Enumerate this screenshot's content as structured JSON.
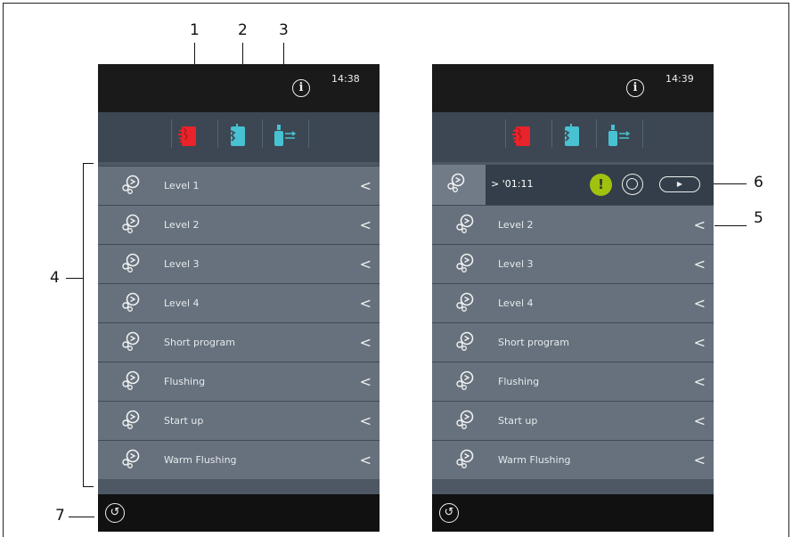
{
  "callouts": {
    "n1": "1",
    "n2": "2",
    "n3": "3",
    "n4": "4",
    "n5": "5",
    "n6": "6",
    "n7": "7"
  },
  "left_screen": {
    "time": "14:38",
    "info_icon": "i",
    "programs": [
      {
        "label": "Level 1",
        "chevron": "<"
      },
      {
        "label": "Level 2",
        "chevron": "<"
      },
      {
        "label": "Level 3",
        "chevron": "<"
      },
      {
        "label": "Level 4",
        "chevron": "<"
      },
      {
        "label": "Short program",
        "chevron": "<"
      },
      {
        "label": "Flushing",
        "chevron": "<"
      },
      {
        "label": "Start up",
        "chevron": "<"
      },
      {
        "label": "Warm Flushing",
        "chevron": "<"
      }
    ],
    "back_icon": "↺"
  },
  "right_screen": {
    "time": "14:39",
    "info_icon": "i",
    "running_timer": "> '01:11",
    "play_symbol": "▶",
    "programs": [
      {
        "label": "Level 2",
        "chevron": "<"
      },
      {
        "label": "Level 3",
        "chevron": "<"
      },
      {
        "label": "Level 4",
        "chevron": "<"
      },
      {
        "label": "Short program",
        "chevron": "<"
      },
      {
        "label": "Flushing",
        "chevron": "<"
      },
      {
        "label": "Start up",
        "chevron": "<"
      },
      {
        "label": "Warm Flushing",
        "chevron": "<"
      }
    ],
    "back_icon": "↺"
  },
  "colors": {
    "mode1": "#e8232a",
    "mode2": "#48c2d2",
    "mode3": "#48c2d2",
    "status_ok": "#a0c20f"
  },
  "icons": [
    "info-icon",
    "cleaning-mode-1-icon",
    "cleaning-mode-2-icon",
    "cleaning-mode-3-icon",
    "program-icon",
    "status-ok-icon",
    "clock-icon",
    "play-icon",
    "back-icon"
  ]
}
